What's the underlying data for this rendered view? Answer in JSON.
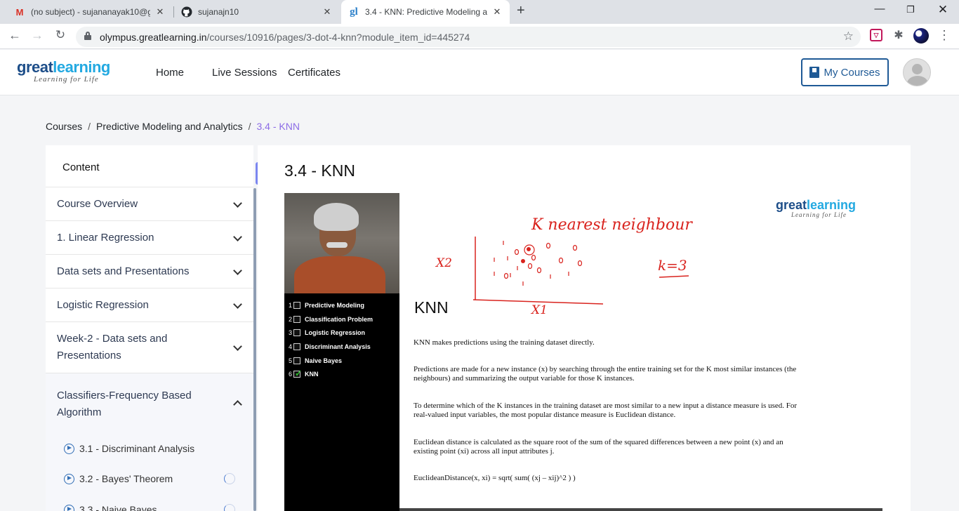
{
  "browser": {
    "tabs": [
      {
        "title": "(no subject) - sujananayak10@gm",
        "icon": "gmail-icon"
      },
      {
        "title": "sujanajn10",
        "icon": "github-icon"
      },
      {
        "title": "3.4 - KNN: Predictive Modeling a",
        "icon": "greatlearning-icon"
      }
    ],
    "url": {
      "host": "olympus.greatlearning.in",
      "path": "/courses/10916/pages/3-dot-4-knn?module_item_id=445274"
    }
  },
  "header": {
    "logo_main": "great",
    "logo_accent": "learning",
    "logo_tagline": "Learning for Life",
    "nav": [
      "Home",
      "Live Sessions",
      "Certificates"
    ],
    "my_courses": "My Courses"
  },
  "breadcrumb": [
    "Courses",
    "Predictive Modeling and Analytics",
    "3.4 - KNN"
  ],
  "sidebar": {
    "title": "Content",
    "sections": [
      {
        "label": "Course Overview"
      },
      {
        "label": "1. Linear Regression"
      },
      {
        "label": "Data sets and Presentations"
      },
      {
        "label": "Logistic Regression"
      },
      {
        "label": "Week-2 - Data sets and Presentations"
      },
      {
        "label": "Classifiers-Frequency Based Algorithm"
      }
    ],
    "items": [
      {
        "label": "3.1 - Discriminant Analysis"
      },
      {
        "label": "3.2 - Bayes' Theorem"
      },
      {
        "label": "3.3 - Naive Bayes"
      }
    ]
  },
  "page": {
    "title": "3.4 - KNN"
  },
  "video": {
    "topics": [
      {
        "n": "1",
        "label": "Predictive Modeling"
      },
      {
        "n": "2",
        "label": "Classification Problem"
      },
      {
        "n": "3",
        "label": "Logistic Regression"
      },
      {
        "n": "4",
        "label": "Discriminant Analysis"
      },
      {
        "n": "5",
        "label": "Naive Bayes"
      },
      {
        "n": "6",
        "label": "KNN"
      }
    ],
    "slide": {
      "heading": "KNN",
      "paragraphs": [
        "KNN makes predictions using the training dataset directly.",
        "Predictions are made for a new instance (x) by searching through the entire training set for the K most similar instances (the neighbours) and summarizing the output variable for those K instances.",
        "To determine which of the K instances in the training dataset are most similar to a new input a distance measure is used. For real-valued input variables, the most popular distance measure is Euclidean distance.",
        "Euclidean distance is calculated as the square root of the sum of the squared differences between a new point (x) and an existing point (xi) across all input attributes j.",
        "EuclideanDistance(x, xi) = sqrt( sum( (xj – xij)^2 ) )"
      ],
      "handwriting": {
        "title": "K nearest neighbour",
        "x_axis": "X1",
        "y_axis": "X2",
        "k_value": "k=3",
        "ink_color": "#d9231e"
      }
    }
  }
}
